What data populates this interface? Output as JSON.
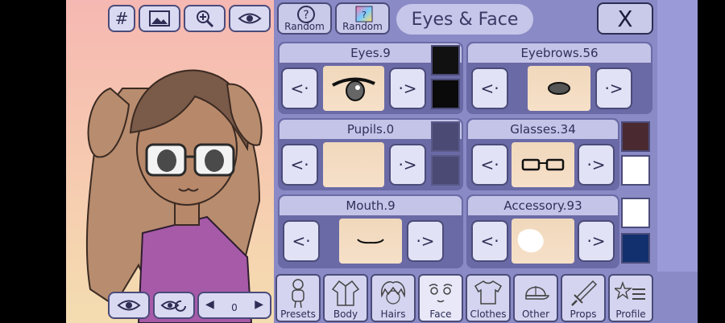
{
  "top_tools": {
    "grid_label": "#"
  },
  "header": {
    "random_left_label": "Random",
    "random_right_label": "Random",
    "title": "Eyes & Face",
    "close_label": "X"
  },
  "sections": {
    "eyes": {
      "title": "Eyes.9",
      "colors": [
        "#111111",
        "#0a0a0a"
      ]
    },
    "eyebrows": {
      "title": "Eyebrows.56"
    },
    "pupils": {
      "title": "Pupils.0"
    },
    "glasses": {
      "title": "Glasses.34",
      "colors": [
        "#4a2a30",
        "#ffffff"
      ]
    },
    "mouth": {
      "title": "Mouth.9"
    },
    "accessory": {
      "title": "Accessory.93",
      "colors": [
        "#ffffff",
        "#12306e"
      ]
    }
  },
  "tabs": [
    {
      "label": "Presets",
      "icon": "person-icon"
    },
    {
      "label": "Body",
      "icon": "jacket-icon"
    },
    {
      "label": "Hairs",
      "icon": "hair-icon"
    },
    {
      "label": "Face",
      "icon": "face-icon"
    },
    {
      "label": "Clothes",
      "icon": "shirt-icon"
    },
    {
      "label": "Other",
      "icon": "cap-icon"
    },
    {
      "label": "Props",
      "icon": "sword-icon"
    },
    {
      "label": "Profile",
      "icon": "star-list-icon"
    }
  ],
  "pose_selector": {
    "value": "0"
  },
  "colors": {
    "panel": "#8a8ac6",
    "button": "#d9d9f2",
    "outline": "#4b4b7a"
  }
}
